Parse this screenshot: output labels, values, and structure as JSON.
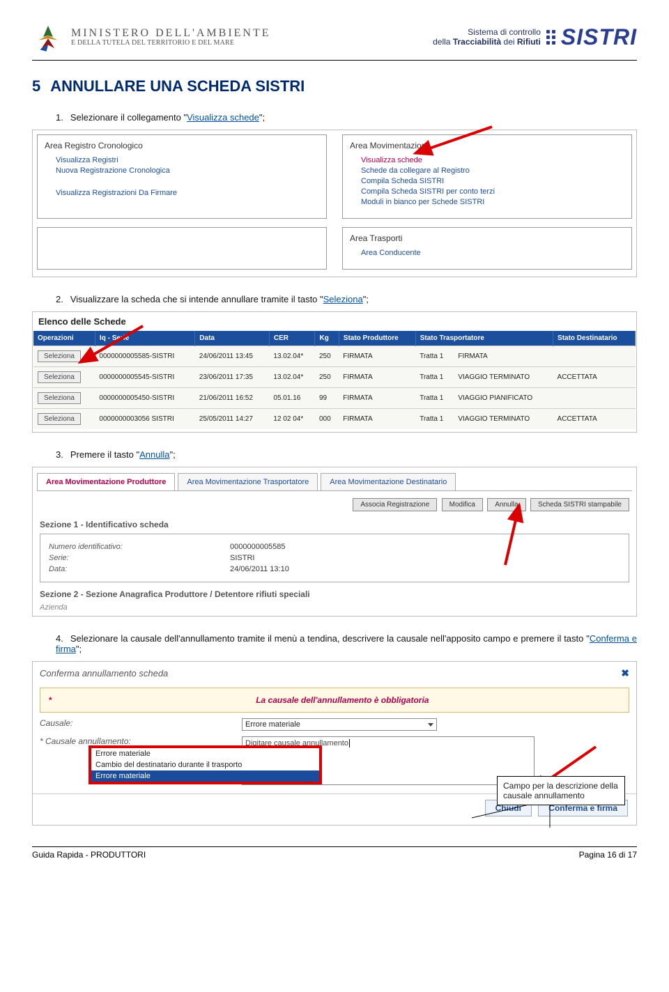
{
  "header": {
    "ministry_title": "MINISTERO DELL'AMBIENTE",
    "ministry_sub": "E DELLA TUTELA DEL TERRITORIO E DEL MARE",
    "sistri_desc1": "Sistema di controllo",
    "sistri_desc2a": "della ",
    "sistri_desc2b": "Tracciabilità",
    "sistri_desc2c": " dei ",
    "sistri_desc2d": "Rifiuti",
    "sistri_logo": "SISTRI"
  },
  "section": {
    "num": "5",
    "title": "ANNULLARE UNA SCHEDA SISTRI"
  },
  "step1": {
    "num": "1.",
    "text_a": "Selezionare il collegamento \"",
    "link": "Visualizza schede",
    "text_b": "\";"
  },
  "scr1": {
    "left_title": "Area Registro Cronologico",
    "left_links": [
      "Visualizza Registri",
      "Nuova Registrazione Cronologica",
      "Visualizza Registrazioni Da Firmare"
    ],
    "right_title": "Area Movimentazione",
    "right_links": [
      "Visualizza schede",
      "Schede da collegare al Registro",
      "Compila Scheda SISTRI",
      "Compila Scheda SISTRI per conto terzi",
      "Moduli in bianco per Schede SISTRI"
    ],
    "bottom_title": "Area Trasporti",
    "bottom_link": "Area Conducente"
  },
  "step2": {
    "num": "2.",
    "text_a": "Visualizzare la scheda che si intende annullare tramite il tasto \"",
    "link": "Seleziona",
    "text_b": "\";"
  },
  "scr2": {
    "heading": "Elenco delle Schede",
    "cols": [
      "Operazioni",
      "Iq - Serie",
      "Data",
      "CER",
      "Kg",
      "Stato Produttore",
      "Stato Trasportatore",
      "Stato Destinatario"
    ],
    "rows": [
      {
        "btn": "Seleziona",
        "serie": "0000000005585-SISTRI",
        "data": "24/06/2011 13:45",
        "cer": "13.02.04*",
        "kg": "250",
        "sp": "FIRMATA",
        "tr_a": "Tratta 1",
        "tr_b": "FIRMATA",
        "sd": ""
      },
      {
        "btn": "Seleziona",
        "serie": "0000000005545-SISTRI",
        "data": "23/06/2011 17:35",
        "cer": "13.02.04*",
        "kg": "250",
        "sp": "FIRMATA",
        "tr_a": "Tratta 1",
        "tr_b": "VIAGGIO TERMINATO",
        "sd": "ACCETTATA"
      },
      {
        "btn": "Seleziona",
        "serie": "0000000005450-SISTRI",
        "data": "21/06/2011 16:52",
        "cer": "05.01.16",
        "kg": "99",
        "sp": "FIRMATA",
        "tr_a": "Tratta 1",
        "tr_b": "VIAGGIO PIANIFICATO",
        "sd": ""
      },
      {
        "btn": "Seleziona",
        "serie": "0000000003056 SISTRI",
        "data": "25/05/2011 14:27",
        "cer": "12 02 04*",
        "kg": "000",
        "sp": "FIRMATA",
        "tr_a": "Tratta 1",
        "tr_b": "VIAGGIO TERMINATO",
        "sd": "ACCETTATA"
      }
    ]
  },
  "step3": {
    "num": "3.",
    "text_a": "Premere il tasto \"",
    "link": "Annulla",
    "text_b": "\";"
  },
  "scr3": {
    "tabs": [
      "Area Movimentazione Produttore",
      "Area Movimentazione Trasportatore",
      "Area Movimentazione Destinatario"
    ],
    "btns": [
      "Associa Registrazione",
      "Modifica",
      "Annulla",
      "Scheda SISTRI stampabile"
    ],
    "sec1": "Sezione 1 - Identificativo scheda",
    "fields": [
      {
        "lab": "Numero identificativo:",
        "val": "0000000005585"
      },
      {
        "lab": "Serie:",
        "val": "SISTRI"
      },
      {
        "lab": "Data:",
        "val": "24/06/2011 13:10"
      }
    ],
    "sec2": "Sezione 2 - Sezione Anagrafica Produttore / Detentore rifiuti speciali",
    "azienda": "Azienda"
  },
  "step4": {
    "num": "4.",
    "text_a": "Selezionare la causale dell'annullamento tramite il menù a tendina, descrivere la causale nell'apposito campo e premere il tasto \"",
    "link": "Conferma e firma",
    "text_b": "\";"
  },
  "scr4": {
    "title": "Conferma annullamento scheda",
    "warn": "La causale dell'annullamento è obbligatoria",
    "causale_lab": "Causale:",
    "causale_val": "Errore materiale",
    "desc_lab": "* Causale annullamento:",
    "desc_val": "Digitare causale annullamento",
    "options": [
      "Errore materiale",
      "Cambio del destinatario durante il trasporto",
      "Errore materiale"
    ],
    "chiudi": "Chiudi",
    "conferma": "Conferma e firma",
    "callout": "Campo per la descrizione della causale annullamento"
  },
  "footer": {
    "left": "Guida Rapida - PRODUTTORI",
    "right": "Pagina 16 di 17"
  }
}
